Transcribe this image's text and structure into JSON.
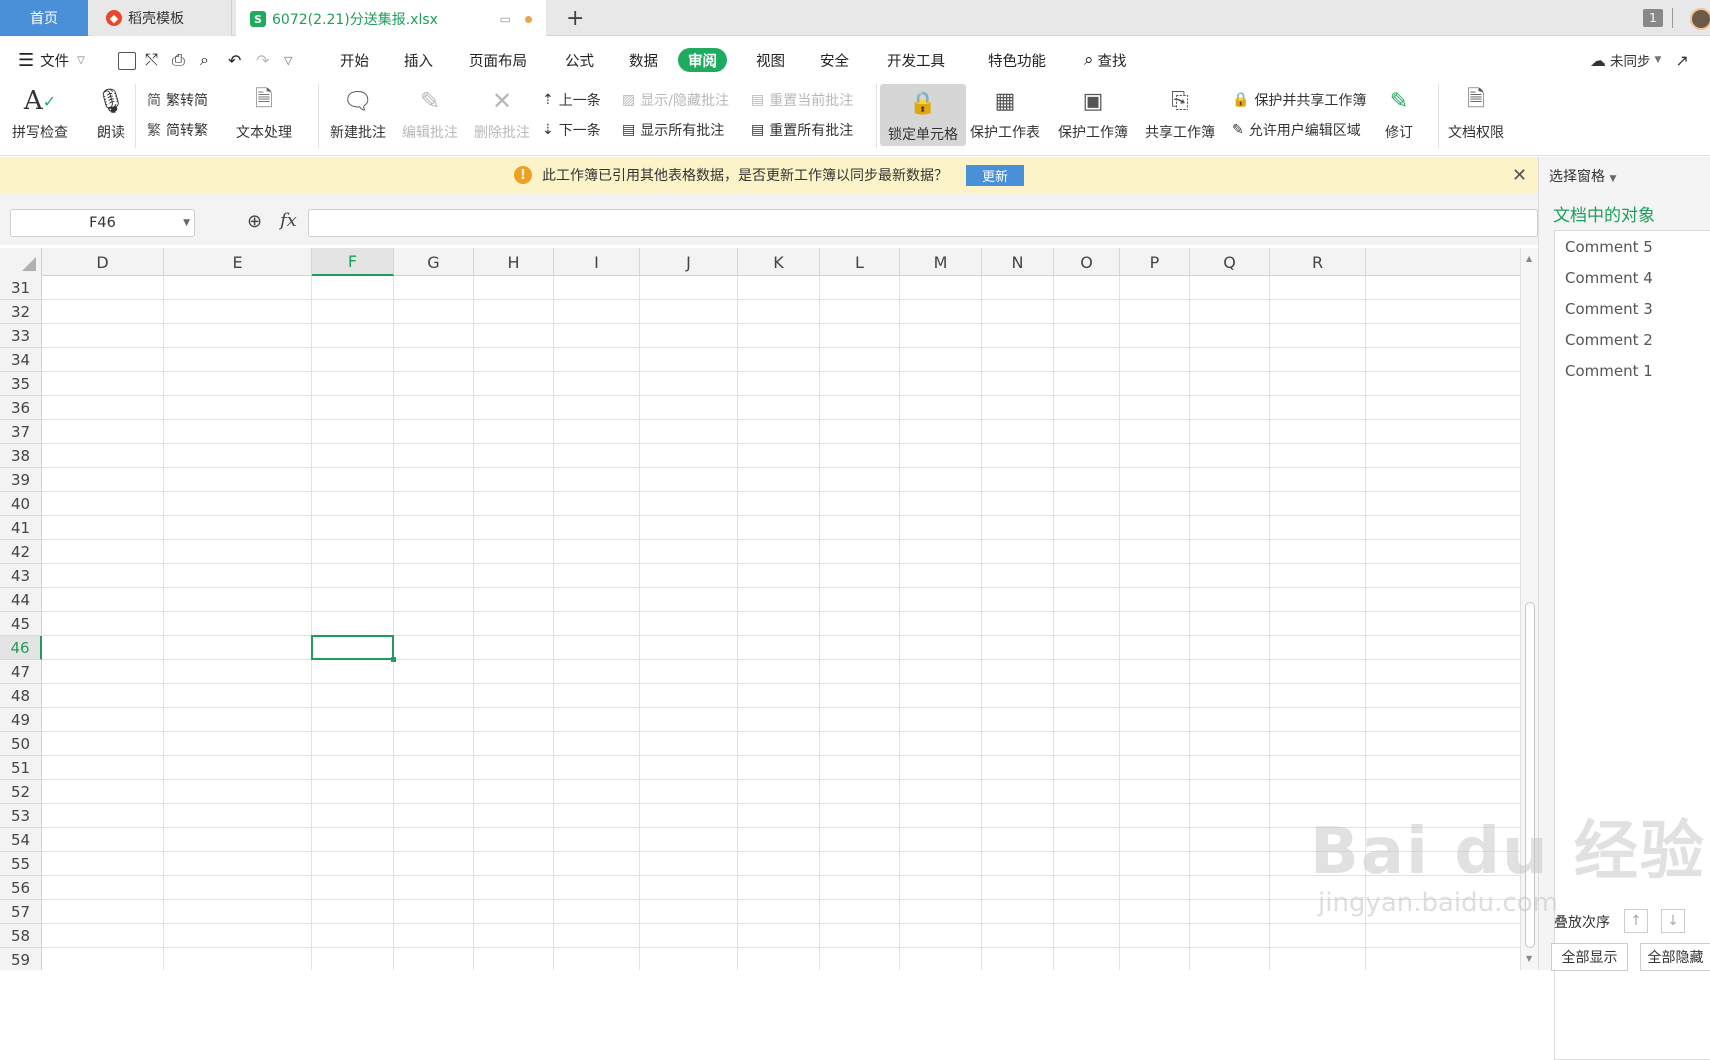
{
  "tabs": {
    "home": "首页",
    "template": "稻壳模板",
    "file": "6072(2.21)分送集报.xlsx",
    "file_logo": "S",
    "window_count": "1"
  },
  "menu": {
    "file": "文件",
    "items": [
      "开始",
      "插入",
      "页面布局",
      "公式",
      "数据",
      "审阅",
      "视图",
      "安全",
      "开发工具",
      "特色功能"
    ],
    "search": "查找",
    "sync": "未同步"
  },
  "ribbon": {
    "spell_check": "拼写检查",
    "read_aloud": "朗读",
    "trad_to_simp": "繁转简",
    "simp_to_trad": "简转繁",
    "text_processing": "文本处理",
    "new_comment": "新建批注",
    "edit_comment": "编辑批注",
    "delete_comment": "删除批注",
    "prev": "上一条",
    "next": "下一条",
    "show_hide_comment": "显示/隐藏批注",
    "show_all_comments": "显示所有批注",
    "reset_current_comment": "重置当前批注",
    "reset_all_comments": "重置所有批注",
    "lock_cell": "锁定单元格",
    "protect_sheet": "保护工作表",
    "protect_workbook": "保护工作簿",
    "share_workbook": "共享工作簿",
    "protect_share_workbook": "保护并共享工作簿",
    "allow_edit_ranges": "允许用户编辑区域",
    "track_changes": "修订",
    "doc_permissions": "文档权限"
  },
  "notification": {
    "message": "此工作簿已引用其他表格数据，是否更新工作簿以同步最新数据？",
    "button": "更新"
  },
  "formula_bar": {
    "name_box": "F46",
    "fx": "fx",
    "formula": ""
  },
  "sheet": {
    "columns": [
      "D",
      "E",
      "F",
      "G",
      "H",
      "I",
      "J",
      "K",
      "L",
      "M",
      "N",
      "O",
      "P",
      "Q",
      "R"
    ],
    "rows": [
      31,
      32,
      33,
      34,
      35,
      36,
      37,
      38,
      39,
      40,
      41,
      42,
      43,
      44,
      45,
      46,
      47,
      48,
      49,
      50,
      51,
      52,
      53,
      54,
      55,
      56,
      57,
      58,
      59
    ],
    "selected_column": "F",
    "selected_row": 46
  },
  "selection_pane": {
    "title": "选择窗格",
    "heading": "文档中的对象",
    "objects": [
      "Comment 5",
      "Comment 4",
      "Comment 3",
      "Comment 2",
      "Comment 1"
    ],
    "order_label": "叠放次序",
    "show_all": "全部显示",
    "hide_all": "全部隐藏"
  },
  "watermark": {
    "main": "Bai du 经验",
    "sub": "jingyan.baidu.com"
  },
  "colors": {
    "accent": "#1e9e5a",
    "home_tab": "#4a90d9",
    "notify_bg": "#fdf3c8"
  }
}
